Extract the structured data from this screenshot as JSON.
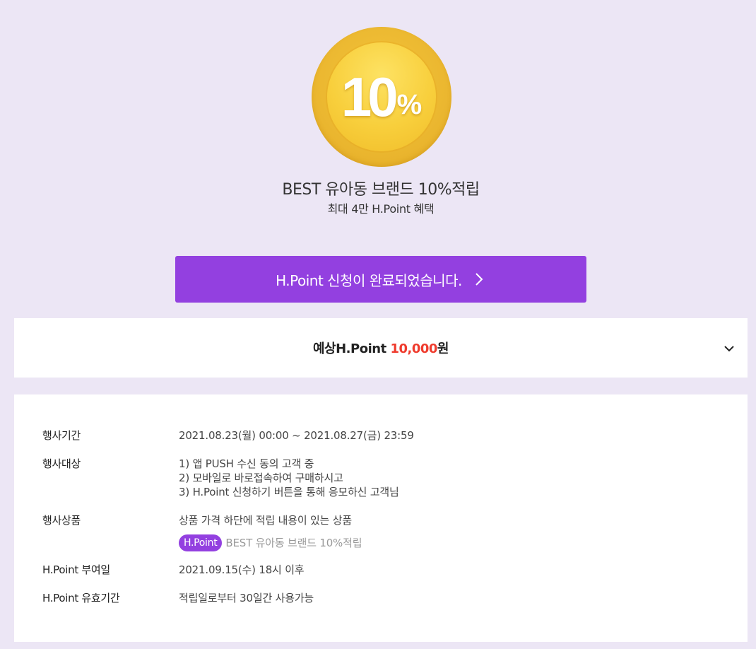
{
  "hero": {
    "coin_number": "10",
    "coin_percent": "%",
    "title": "BEST 유아동 브랜드 10%적립",
    "subtitle": "최대 4만 H.Point 혜택",
    "coin_colors": {
      "outer": "#ebb730",
      "inner": "#f8cf3c"
    }
  },
  "apply_button": {
    "label": "H.Point 신청이 완료되었습니다.",
    "icon": "chevron-right-icon",
    "color": "#9340e0"
  },
  "points_panel": {
    "label": "예상H.Point",
    "value": "10,000",
    "unit": "원",
    "icon": "chevron-down-icon",
    "value_color": "#ef3b2d"
  },
  "details": {
    "period": {
      "label": "행사기간",
      "value": "2021.08.23(월) 00:00 ~ 2021.08.27(금) 23:59"
    },
    "target": {
      "label": "행사대상",
      "lines": [
        "1) 앱 PUSH 수신 동의 고객 중",
        "2) 모바일로 바로접속하여 구매하시고",
        "3) H.Point 신청하기 버튼을 통해 응모하신 고객님"
      ]
    },
    "products": {
      "label": "행사상품",
      "value": "상품 가격 하단에 적립 내용이 있는 상품",
      "badge": "H.Point",
      "badge_desc": "BEST 유아동 브랜드 10%적립"
    },
    "grant_date": {
      "label": "H.Point 부여일",
      "value": "2021.09.15(수) 18시 이후"
    },
    "validity": {
      "label": "H.Point 유효기간",
      "value": "적립일로부터 30일간 사용가능"
    }
  },
  "colors": {
    "background": "#ece6f5",
    "accent": "#9340e0"
  }
}
